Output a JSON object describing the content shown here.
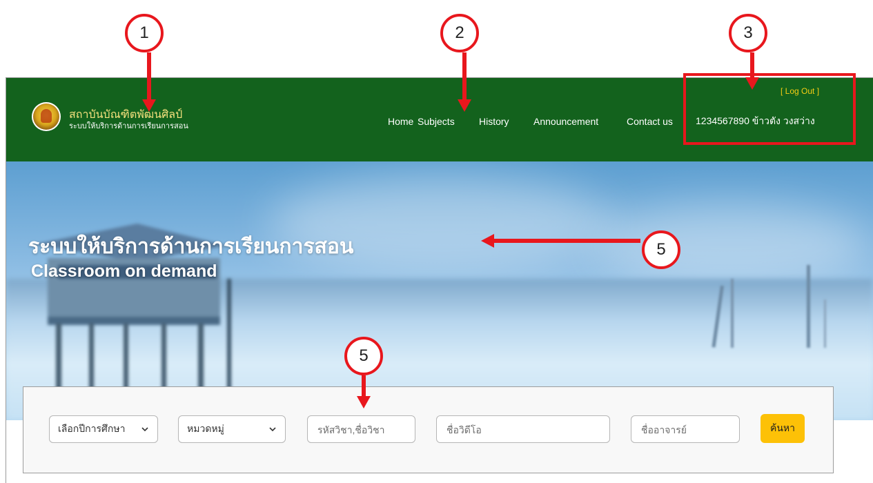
{
  "header": {
    "logo_title": "สถาบันบัณฑิตพัฒนศิลป์",
    "logo_subtitle": "ระบบให้บริการด้านการเรียนการสอน",
    "nav": [
      {
        "label": "Home"
      },
      {
        "label": "Subjects"
      },
      {
        "label": "History"
      },
      {
        "label": "Announcement"
      },
      {
        "label": "Contact us"
      }
    ],
    "logout_label": "[ Log Out ]",
    "user_label": "1234567890 ข้าวตัง วงสว่าง"
  },
  "hero": {
    "title_th": "ระบบให้บริการด้านการเรียนการสอน",
    "title_en": "Classroom on demand"
  },
  "search": {
    "year_select": "เลือกปีการศึกษา",
    "category_select": "หมวดหมู่",
    "subject_placeholder": "รหัสวิชา,ชื่อวิชา",
    "video_placeholder": "ชื่อวิดีโอ",
    "teacher_placeholder": "ชื่ออาจารย์",
    "button_label": "ค้นหา"
  },
  "annotations": {
    "markers": [
      "1",
      "2",
      "3",
      "5",
      "5"
    ],
    "color": "#e8171d"
  },
  "colors": {
    "header_bg": "#13621d",
    "logo_title": "#f4e07d",
    "logout": "#f5cd14",
    "search_button": "#fdc107"
  }
}
